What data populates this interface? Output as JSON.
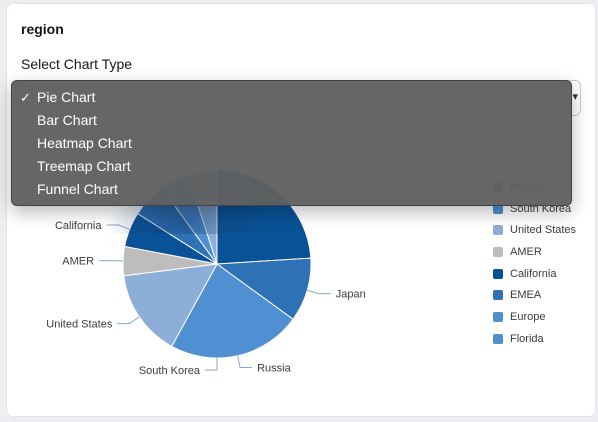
{
  "panel": {
    "title": "region",
    "select_label": "Select Chart Type",
    "selected_value": "Pie Chart"
  },
  "menu": {
    "options": [
      "Pie Chart",
      "Bar Chart",
      "Heatmap Chart",
      "Treemap Chart",
      "Funnel Chart"
    ],
    "selected_index": 0,
    "check_glyph": "✓"
  },
  "chart_data": {
    "type": "pie",
    "slices": [
      {
        "name": "Japan",
        "value": 24,
        "color": "#0a5297"
      },
      {
        "name": "Japan",
        "value": 11,
        "color": "#2f71b5"
      },
      {
        "name": "Russia",
        "value": 23,
        "color": "#4f8fd2"
      },
      {
        "name": "South Korea",
        "value": 15,
        "color": "#8daed8"
      },
      {
        "name": "United States",
        "value": 5,
        "color": "#bdbdbd"
      },
      {
        "name": "AMER",
        "value": 6,
        "color": "#0a5297"
      },
      {
        "name": "California",
        "value": 6,
        "color": "#2f71b5"
      },
      {
        "name": "EMEA",
        "value": 5,
        "color": "#4f8fd2"
      },
      {
        "name": "Europe",
        "value": 5,
        "color": "#8daed8"
      }
    ],
    "visible_labels": [
      "California",
      "AMER",
      "United States",
      "South Korea",
      "Russia",
      "Japan"
    ],
    "legend": [
      {
        "name": "Russia",
        "color": "#4f8fd2"
      },
      {
        "name": "South Korea",
        "color": "#4f8fd2"
      },
      {
        "name": "United States",
        "color": "#8daed8"
      },
      {
        "name": "AMER",
        "color": "#bdbdbd"
      },
      {
        "name": "California",
        "color": "#0a5297"
      },
      {
        "name": "EMEA",
        "color": "#2f71b5"
      },
      {
        "name": "Europe",
        "color": "#4f8fd2"
      },
      {
        "name": "Florida",
        "color": "#4f8fd2"
      }
    ],
    "legend_placement": "right"
  }
}
